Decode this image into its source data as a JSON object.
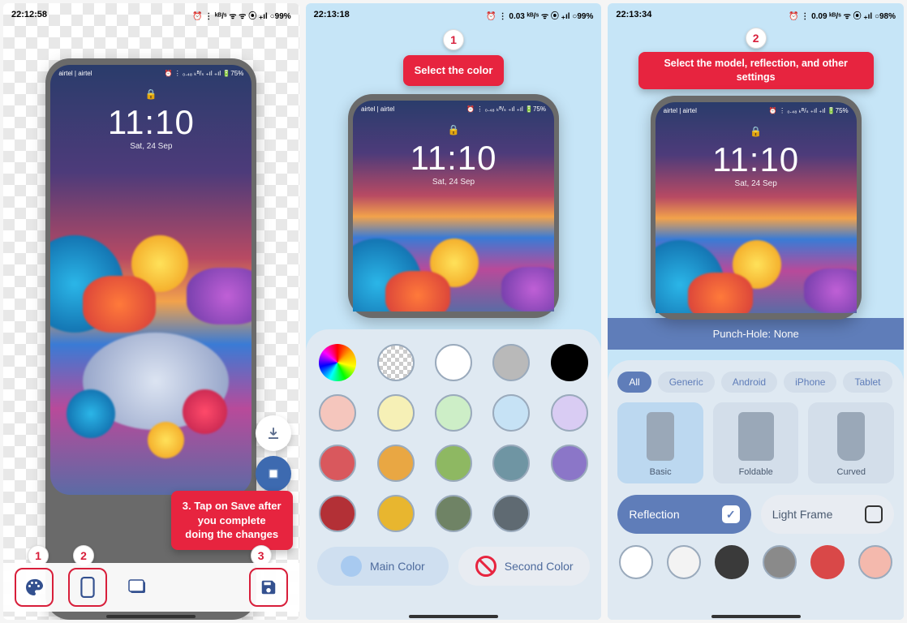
{
  "panel1": {
    "status": {
      "time": "22:12:58",
      "right": "⏰ ⋮ ᵏᴮ/ˢ ᯤ ᯤ ⦿ ₊ıl ○99%"
    },
    "phone": {
      "carrier": "airtel | airtel",
      "status_right": "⏰ ⋮ ₀.₄₈ ₖᴮ/ₛ ₊ıl ₊ıl 🔋75%",
      "lock": "🔒",
      "time": "11:10",
      "date": "Sat, 24 Sep"
    },
    "badges": {
      "b1": "1",
      "b2": "2",
      "b3": "3"
    },
    "callout": "3. Tap on Save after you complete doing the changes"
  },
  "panel2": {
    "status": {
      "time": "22:13:18",
      "right": "⏰ ⋮ 0.03 ᵏᴮ/ˢ ᯤ ⦿ ₊ıl ○99%"
    },
    "badge": "1",
    "callout": "Select the color",
    "phone": {
      "carrier": "airtel | airtel",
      "status_right": "⏰ ⋮ ₀.₄₈ ₖᴮ/ₛ ₊ıl ₊ıl 🔋75%",
      "lock": "🔒",
      "time": "11:10",
      "date": "Sat, 24 Sep"
    },
    "colors_row1": [
      "rainbow",
      "checker",
      "#ffffff",
      "#b9b9b9",
      "#000000"
    ],
    "colors_row2": [
      "#f5c6bd",
      "#f6f0b6",
      "#cdeec7",
      "#c6e2f5",
      "#d9ccf3"
    ],
    "colors_row3": [
      "#d9585d",
      "#e9a743",
      "#8eb862",
      "#6f95a3",
      "#8b76c8"
    ],
    "colors_row4": [
      "#b33036",
      "#e8b62f",
      "#6f8365",
      "#5f6a72",
      ""
    ],
    "main_label": "Main Color",
    "second_label": "Second Color",
    "main_dot": "#a8caf0"
  },
  "panel3": {
    "status": {
      "time": "22:13:34",
      "right": "⏰ ⋮ 0.09 ᵏᴮ/ˢ ᯤ ⦿ ₊ıl ○98%"
    },
    "badge": "2",
    "callout": "Select the model, reflection, and other settings",
    "phone": {
      "carrier": "airtel | airtel",
      "status_right": "⏰ ⋮ ₀.₄₈ ₖᴮ/ₛ ₊ıl ₊ıl 🔋75%",
      "lock": "🔒",
      "time": "11:10",
      "date": "Sat, 24 Sep"
    },
    "punch": "Punch-Hole: None",
    "chips": [
      "All",
      "Generic",
      "Android",
      "iPhone",
      "Tablet"
    ],
    "models": [
      {
        "label": "Basic",
        "shape": "basic",
        "active": true
      },
      {
        "label": "Foldable",
        "shape": "fold",
        "active": false
      },
      {
        "label": "Curved",
        "shape": "curved",
        "active": false
      }
    ],
    "reflection": "Reflection",
    "lightframe": "Light Frame",
    "bottom_colors": [
      "#ffffff",
      "#f3f3f3",
      "#3a3a3a",
      "#8a8a8a",
      "#d94848",
      "#f4b9ad"
    ]
  }
}
